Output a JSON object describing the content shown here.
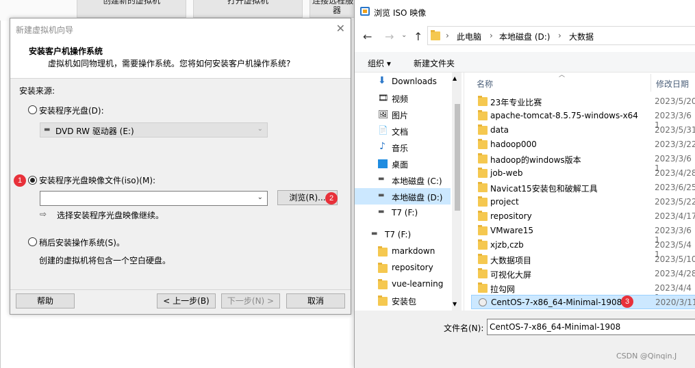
{
  "background": {
    "buttons": [
      "创建新的虚拟机",
      "打开虚拟机",
      "连接远程服务器"
    ]
  },
  "wizard": {
    "title": "新建虚拟机向导",
    "heading": "安装客户机操作系统",
    "subheading": "虚拟机如同物理机，需要操作系统。您将如何安装客户机操作系统?",
    "source_label": "安装来源:",
    "option_disc": "安装程序光盘(D):",
    "disc_drive": "DVD RW 驱动器 (E:)",
    "option_iso": "安装程序光盘映像文件(iso)(M):",
    "iso_value": "",
    "browse_button": "浏览(R)...",
    "hint": "选择安装程序光盘映像继续。",
    "option_later": "稍后安装操作系统(S)。",
    "later_desc": "创建的虚拟机将包含一个空白硬盘。",
    "help_button": "帮助",
    "back_button": "< 上一步(B)",
    "next_button": "下一步(N) >",
    "cancel_button": "取消",
    "selected_option": "iso"
  },
  "badges": [
    "1",
    "2",
    "3"
  ],
  "browse_dialog": {
    "title": "浏览 ISO 映像",
    "breadcrumb": [
      "此电脑",
      "本地磁盘 (D:)",
      "大数据"
    ],
    "toolbar": {
      "organize": "组织 ▾",
      "new_folder": "新建文件夹"
    },
    "nav_items": [
      {
        "label": "Downloads",
        "icon": "download-arrow-icon"
      },
      {
        "label": "视频",
        "icon": "video-icon"
      },
      {
        "label": "图片",
        "icon": "picture-icon"
      },
      {
        "label": "文档",
        "icon": "document-icon"
      },
      {
        "label": "音乐",
        "icon": "music-icon"
      },
      {
        "label": "桌面",
        "icon": "desktop-icon"
      },
      {
        "label": "本地磁盘 (C:)",
        "icon": "drive-icon"
      },
      {
        "label": "本地磁盘 (D:)",
        "icon": "drive-icon",
        "selected": true
      },
      {
        "label": "T7 (F:)",
        "icon": "drive-icon"
      },
      {
        "label": "T7 (F:)",
        "icon": "drive-icon"
      },
      {
        "label": "markdown",
        "icon": "folder-icon"
      },
      {
        "label": "repository",
        "icon": "folder-icon"
      },
      {
        "label": "vue-learning",
        "icon": "folder-icon"
      },
      {
        "label": "安装包",
        "icon": "folder-icon"
      }
    ],
    "columns": {
      "name": "名称",
      "modified": "修改日期"
    },
    "files": [
      {
        "name": "23年专业比赛",
        "date": "2023/5/20"
      },
      {
        "name": "apache-tomcat-8.5.75-windows-x64",
        "date": "2023/3/6 1"
      },
      {
        "name": "data",
        "date": "2023/5/31"
      },
      {
        "name": "hadoop000",
        "date": "2023/3/22"
      },
      {
        "name": "hadoop的windows版本",
        "date": "2023/3/6 1"
      },
      {
        "name": "job-web",
        "date": "2023/4/28"
      },
      {
        "name": "Navicat15安装包和破解工具",
        "date": "2023/6/25"
      },
      {
        "name": "project",
        "date": "2023/5/22"
      },
      {
        "name": "repository",
        "date": "2023/4/17"
      },
      {
        "name": "VMware15",
        "date": "2023/3/6 1"
      },
      {
        "name": "xjzb,czb",
        "date": "2023/5/4 1"
      },
      {
        "name": "大数据项目",
        "date": "2023/5/10"
      },
      {
        "name": "可视化大屏",
        "date": "2023/4/28"
      },
      {
        "name": "拉勾网",
        "date": "2023/4/4 1"
      },
      {
        "name": "CentOS-7-x86_64-Minimal-1908",
        "date": "2020/3/11",
        "selected": true,
        "icon": "disc-image-icon"
      }
    ],
    "filename_label": "文件名(N):",
    "filename_value": "CentOS-7-x86_64-Minimal-1908"
  },
  "watermark": "CSDN @Qinqin.J"
}
